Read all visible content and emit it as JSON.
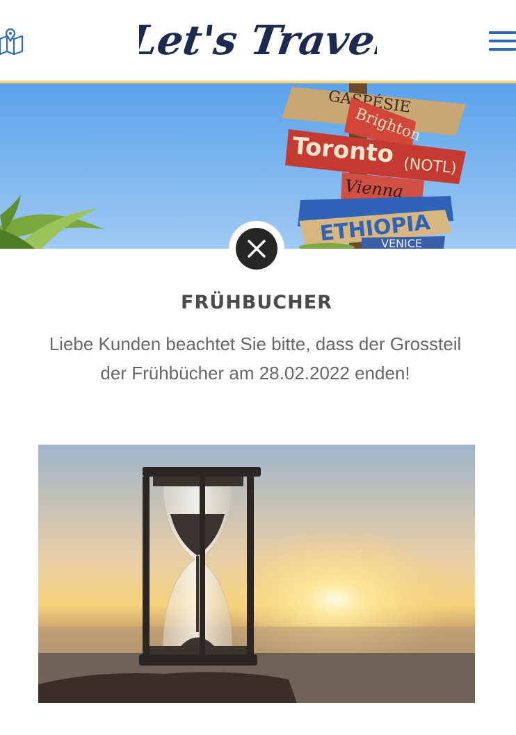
{
  "header": {
    "logo_text": "Let's Travel",
    "map_icon": "map-icon",
    "menu_icon": "hamburger-menu-icon"
  },
  "hero": {
    "signs": {
      "gaspesie": "GASPÉSIE",
      "brighton": "Brighton",
      "toronto": "Toronto",
      "notl": "(NOTL)",
      "vienna": "Vienna",
      "ethiopia": "ETHIOPIA",
      "venice": "VENICE"
    }
  },
  "modal": {
    "close_icon": "close-icon",
    "title": "FRÜHBUCHER",
    "message": "Liebe Kunden beachtet Sie bitte, dass der Grossteil der Frühbücher am 28.02.2022 enden!"
  },
  "colors": {
    "accent_blue": "#2d6cb5",
    "logo_navy": "#1c2a4f",
    "header_border": "#f3d67a",
    "title_gray": "#4a4a4a",
    "text_gray": "#666666"
  }
}
